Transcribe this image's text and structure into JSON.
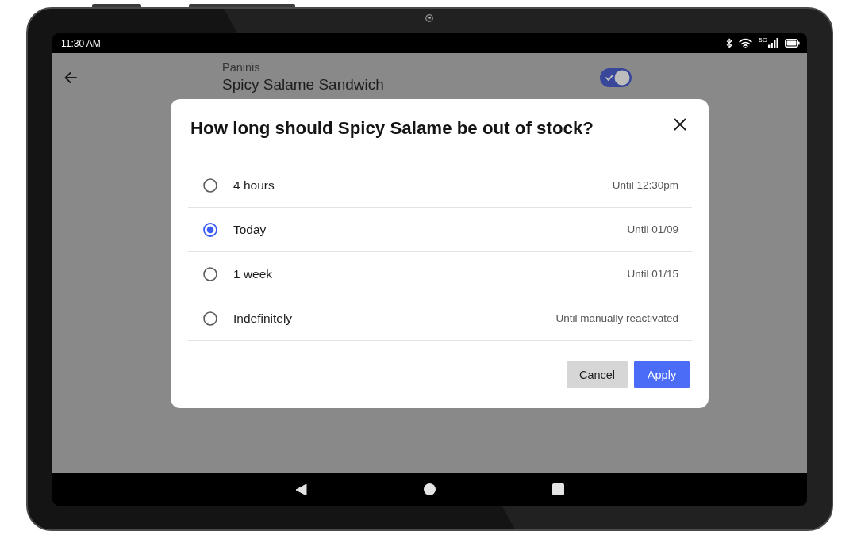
{
  "status_bar": {
    "time": "11:30 AM",
    "network_type": "5G"
  },
  "header": {
    "category": "Paninis",
    "title": "Spicy Salame Sandwich",
    "toggle": {
      "on": true
    }
  },
  "dialog": {
    "title": "How long should Spicy Salame be out of stock?",
    "options": [
      {
        "label": "4 hours",
        "detail": "Until 12:30pm",
        "selected": false
      },
      {
        "label": "Today",
        "detail": "Until 01/09",
        "selected": true
      },
      {
        "label": "1 week",
        "detail": "Until 01/15",
        "selected": false
      },
      {
        "label": "Indefinitely",
        "detail": "Until manually reactivated",
        "selected": false
      }
    ],
    "buttons": [
      {
        "label": "Cancel",
        "kind": "secondary"
      },
      {
        "label": "Apply",
        "kind": "primary"
      }
    ]
  }
}
